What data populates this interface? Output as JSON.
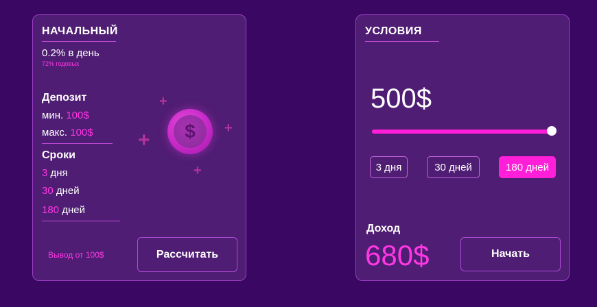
{
  "left_card": {
    "title": "НАЧАЛЬНЫЙ",
    "rate": "0.2% в день",
    "annual": "72% годовых",
    "deposit_heading": "Депозит",
    "min_label": "мин.",
    "min_value": "100$",
    "max_label": "макс.",
    "max_value": "100$",
    "terms_heading": "Сроки",
    "terms": [
      {
        "num": "3",
        "unit": "дня"
      },
      {
        "num": "30",
        "unit": "дней"
      },
      {
        "num": "180",
        "unit": "дней"
      }
    ],
    "withdraw_text": "Вывод от 100$",
    "calc_button": "Рассчитать",
    "coin_symbol": "$",
    "coin_icon": "dollar-coin-icon",
    "plus_glyph": "+"
  },
  "right_card": {
    "title": "УСЛОВИЯ",
    "amount": "500$",
    "slider_level": 1.0,
    "durations": [
      "3 дня",
      "30 дней",
      "180 дней"
    ],
    "active_duration": 2,
    "income_label": "Доход",
    "income_value": "680$",
    "start_button": "Начать"
  },
  "colors": {
    "background": "#3a0863",
    "card": "#4f1d73",
    "border": "#9a3fc4",
    "accent": "#ff1fd9"
  }
}
